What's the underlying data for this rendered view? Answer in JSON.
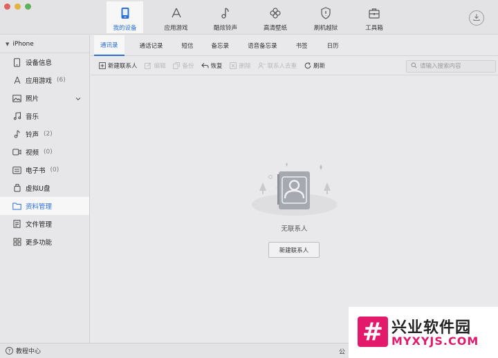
{
  "window": {
    "traffic_lights": [
      "close",
      "minimize",
      "zoom"
    ]
  },
  "top_nav": {
    "items": [
      {
        "label": "我的设备",
        "icon": "phone-icon",
        "active": true
      },
      {
        "label": "应用游戏",
        "icon": "app-store-icon"
      },
      {
        "label": "酷炫铃声",
        "icon": "music-note-icon"
      },
      {
        "label": "高清壁纸",
        "icon": "flower-icon"
      },
      {
        "label": "刷机越狱",
        "icon": "shield-icon"
      },
      {
        "label": "工具箱",
        "icon": "toolbox-icon"
      }
    ],
    "download_icon": "download-icon"
  },
  "sidebar": {
    "device": "iPhone",
    "items": [
      {
        "label": "设备信息",
        "icon": "device-info-icon",
        "count": ""
      },
      {
        "label": "应用游戏",
        "icon": "app-store-icon",
        "count": "(6)"
      },
      {
        "label": "照片",
        "icon": "photo-icon",
        "count": "",
        "expandable": true
      },
      {
        "label": "音乐",
        "icon": "music-icon",
        "count": ""
      },
      {
        "label": "铃声",
        "icon": "ringtone-icon",
        "count": "(2)"
      },
      {
        "label": "视频",
        "icon": "video-icon",
        "count": "(0)"
      },
      {
        "label": "电子书",
        "icon": "ebook-icon",
        "count": "(0)"
      },
      {
        "label": "虚拟U盘",
        "icon": "usb-drive-icon",
        "count": ""
      },
      {
        "label": "资料管理",
        "icon": "folder-icon",
        "count": "",
        "active": true
      },
      {
        "label": "文件管理",
        "icon": "file-icon",
        "count": ""
      },
      {
        "label": "更多功能",
        "icon": "grid-icon",
        "count": ""
      }
    ]
  },
  "tabs": [
    "通讯录",
    "通话记录",
    "短信",
    "备忘录",
    "语音备忘录",
    "书签",
    "日历"
  ],
  "actions": [
    {
      "label": "新建联系人",
      "icon": "add-contact-icon",
      "enabled": true
    },
    {
      "label": "编辑",
      "icon": "edit-icon",
      "enabled": false
    },
    {
      "label": "备份",
      "icon": "backup-icon",
      "enabled": false
    },
    {
      "label": "恢复",
      "icon": "restore-icon",
      "enabled": true
    },
    {
      "label": "删除",
      "icon": "delete-icon",
      "enabled": false
    },
    {
      "label": "联系人去重",
      "icon": "dedupe-icon",
      "enabled": false
    },
    {
      "label": "刷新",
      "icon": "refresh-icon",
      "enabled": true
    }
  ],
  "search": {
    "placeholder": "请输入搜索内容",
    "value": ""
  },
  "empty_state": {
    "message": "无联系人",
    "button": "新建联系人"
  },
  "footer": {
    "help": "教程中心",
    "right_text": "公"
  },
  "watermark": {
    "name": "兴业软件园",
    "url": "MYXYJS.COM"
  },
  "colors": {
    "accent": "#2a6fd6",
    "brand_watermark": "#e3196b"
  }
}
